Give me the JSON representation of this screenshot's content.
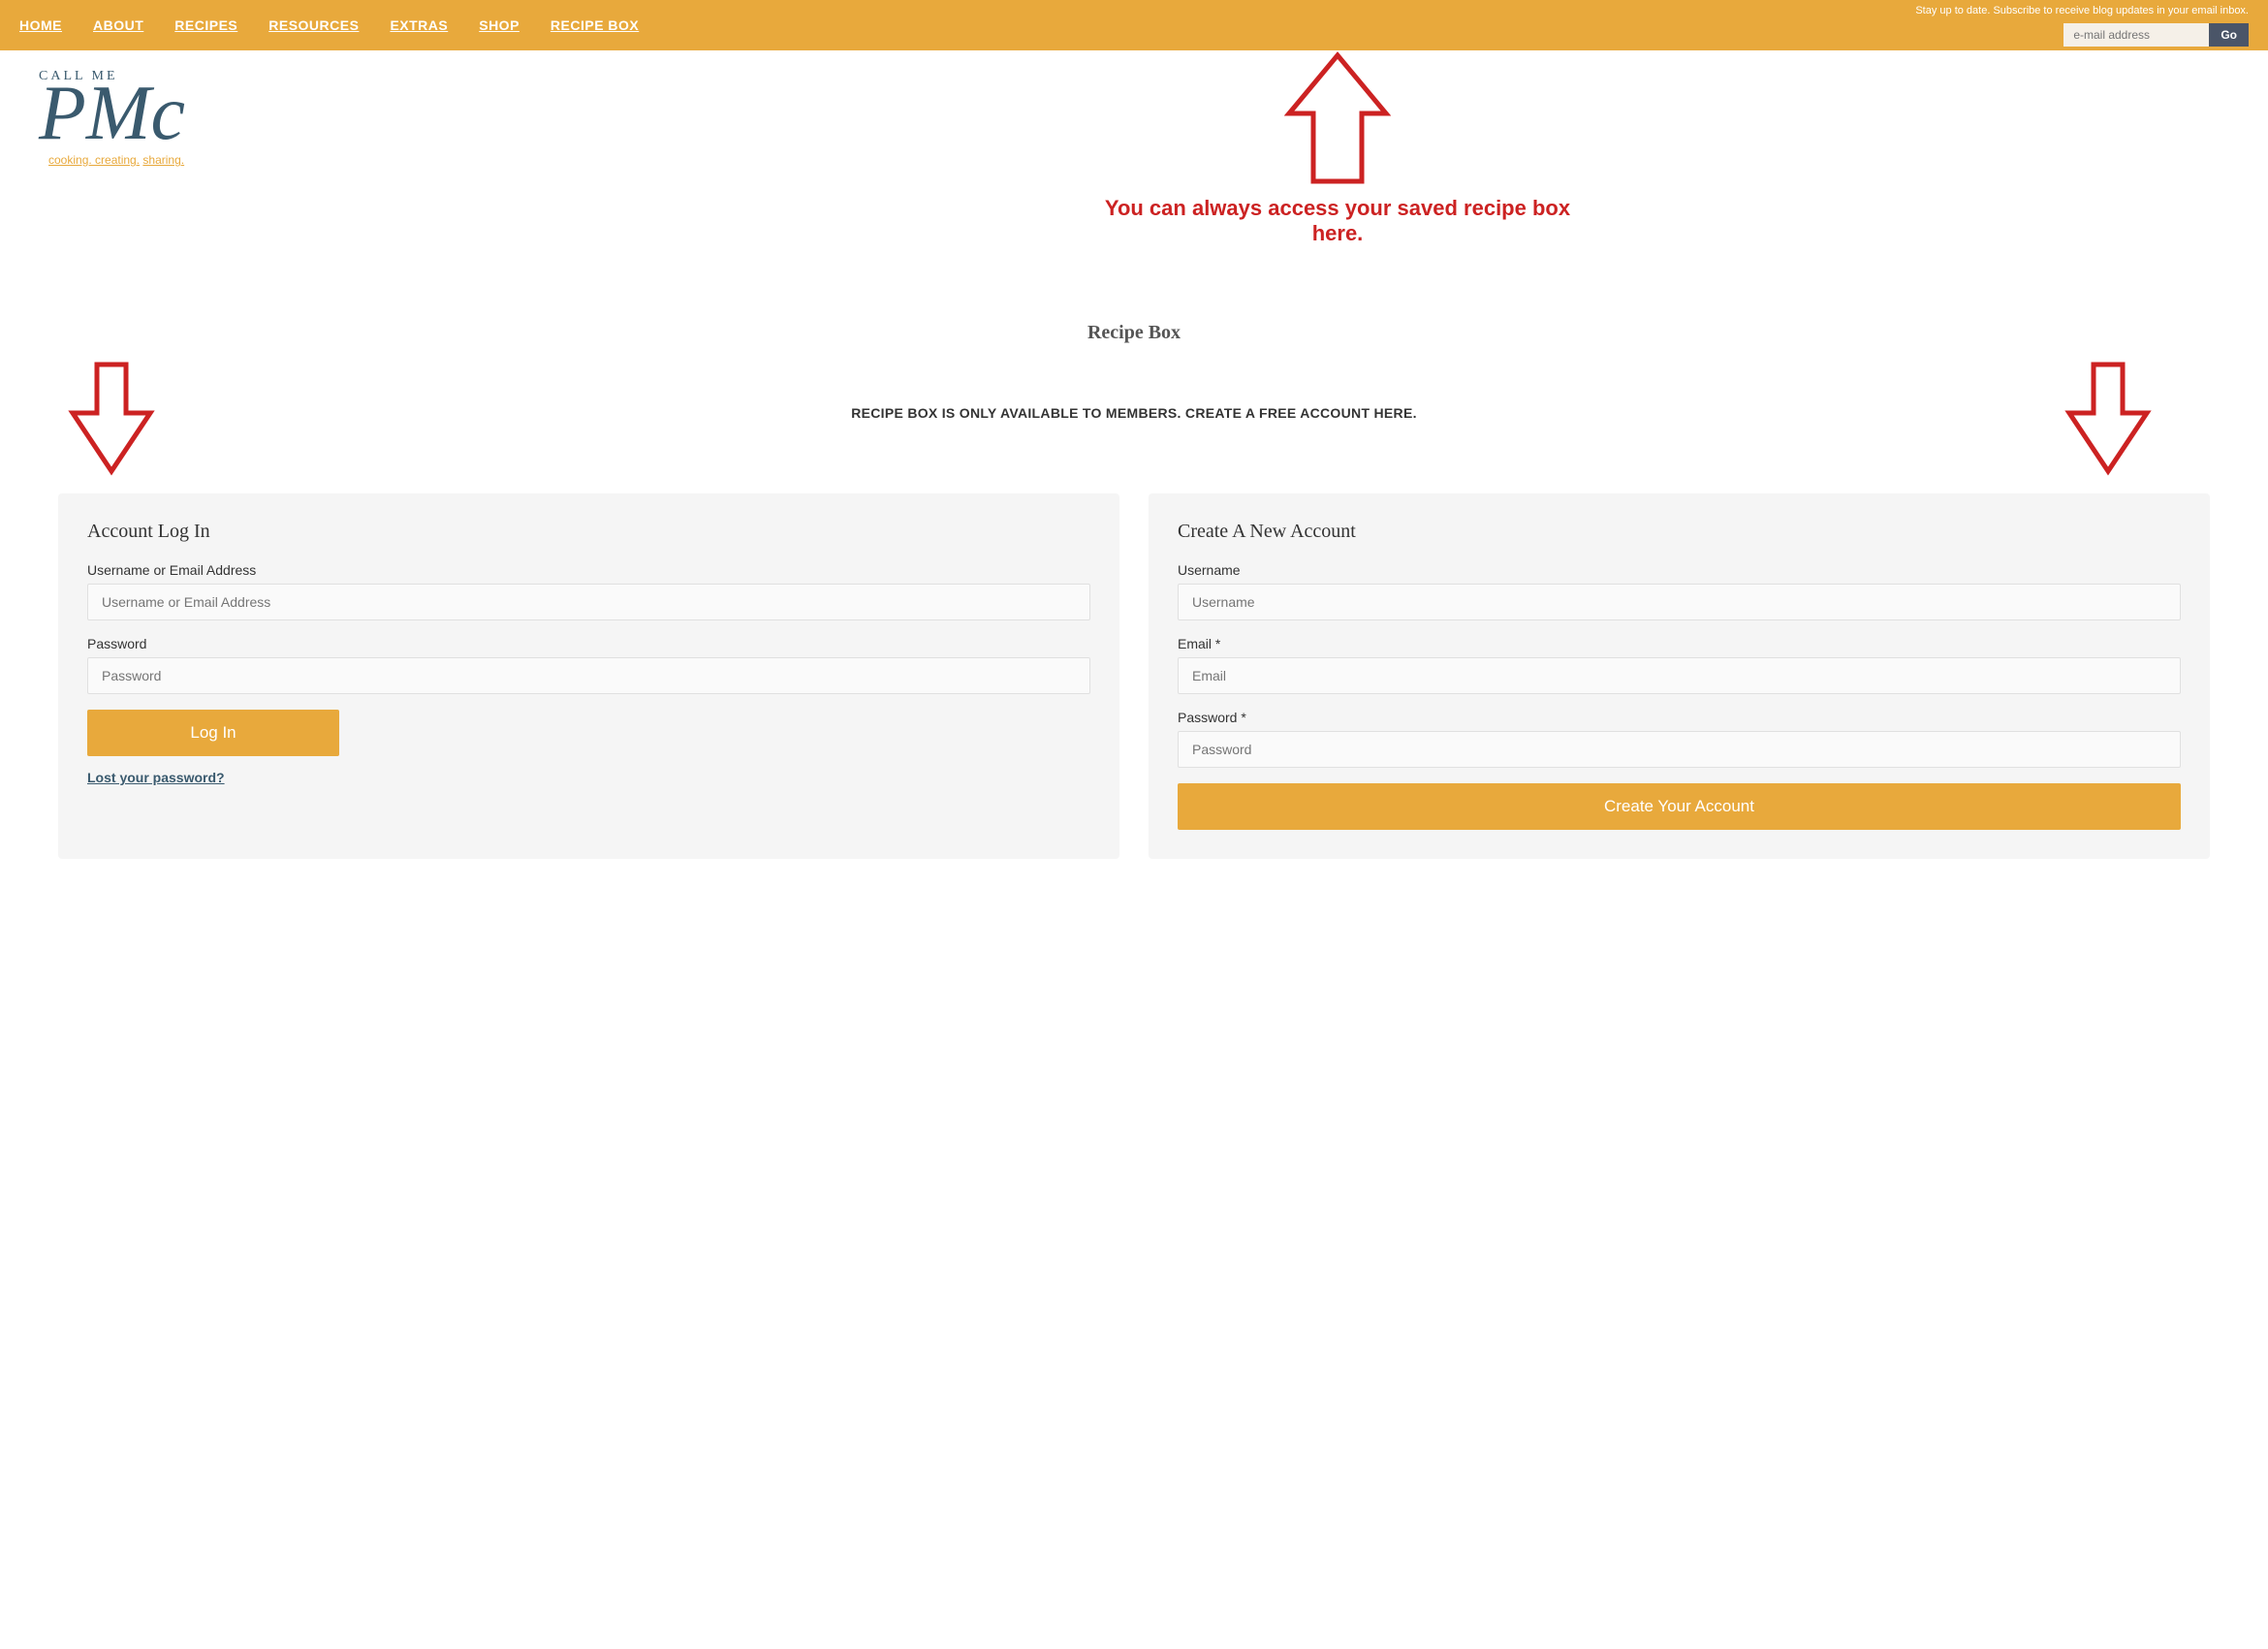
{
  "nav": {
    "links": [
      {
        "label": "HOME",
        "name": "nav-home"
      },
      {
        "label": "ABOUT",
        "name": "nav-about"
      },
      {
        "label": "RECIPES",
        "name": "nav-recipes"
      },
      {
        "label": "RESOURCES",
        "name": "nav-resources"
      },
      {
        "label": "EXTRAS",
        "name": "nav-extras"
      },
      {
        "label": "SHOP",
        "name": "nav-shop"
      },
      {
        "label": "RECIPE BOX",
        "name": "nav-recipe-box"
      }
    ],
    "subscribe_text": "Stay up to date. Subscribe to receive\nblog updates in your email inbox.",
    "subscribe_placeholder": "e-mail address",
    "subscribe_button": "Go"
  },
  "logo": {
    "callme": "CALL ME",
    "pmc": "PMc",
    "tagline_prefix": "cooking. creating.",
    "tagline_accent": "sharing."
  },
  "arrow_message": {
    "text": "You can always access your saved recipe box here."
  },
  "main": {
    "recipe_box_title": "Recipe Box",
    "members_notice": "RECIPE BOX IS ONLY AVAILABLE TO MEMBERS. CREATE A FREE ACCOUNT HERE.",
    "login_panel": {
      "title": "Account Log In",
      "username_label": "Username or Email Address",
      "username_placeholder": "Username or Email Address",
      "password_label": "Password",
      "password_placeholder": "Password",
      "login_button": "Log In",
      "lost_password": "Lost your password?"
    },
    "register_panel": {
      "title": "Create A New Account",
      "username_label": "Username",
      "username_placeholder": "Username",
      "email_label": "Email *",
      "email_placeholder": "Email",
      "password_label": "Password *",
      "password_placeholder": "Password",
      "create_button": "Create Your Account"
    }
  }
}
